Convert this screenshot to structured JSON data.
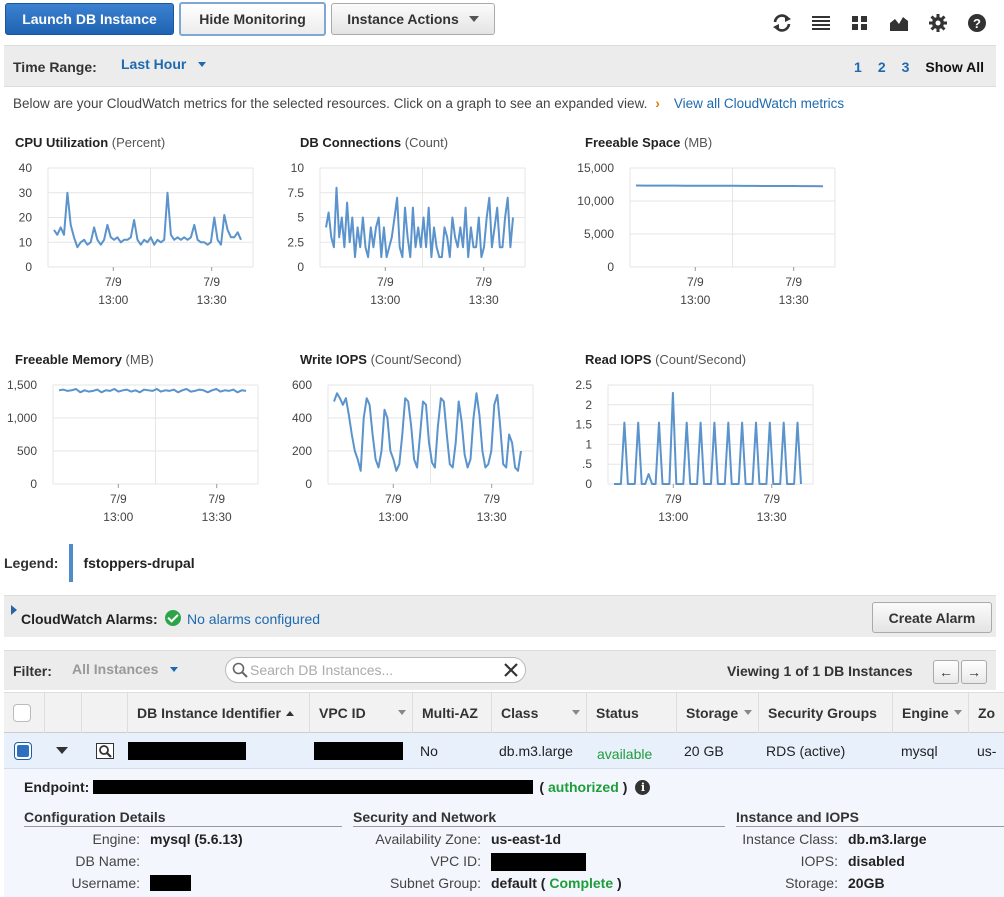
{
  "toolbar": {
    "launch_label": "Launch DB Instance",
    "hide_monitoring_label": "Hide Monitoring",
    "instance_actions_label": "Instance Actions",
    "icons": [
      "refresh-icon",
      "list-view-icon",
      "grid-view-icon",
      "area-chart-icon",
      "gear-icon",
      "help-icon"
    ]
  },
  "time_range": {
    "label": "Time Range:",
    "value": "Last Hour",
    "pages": [
      "1",
      "2",
      "3"
    ],
    "show_all": "Show All"
  },
  "intro": {
    "text": "Below are your CloudWatch metrics for the selected resources. Click on a graph to see an expanded view.",
    "arrow": "›",
    "link": "View all CloudWatch metrics"
  },
  "chart_data": [
    {
      "type": "line",
      "title": "CPU Utilization",
      "unit": "(Percent)",
      "ylim": [
        0,
        40
      ],
      "yticks": [
        "0",
        "10",
        "20",
        "30",
        "40"
      ],
      "xticks": [
        [
          "7/9",
          "13:00"
        ],
        [
          "7/9",
          "13:30"
        ]
      ],
      "color": "#5b93cc",
      "values": [
        15,
        13,
        16,
        13,
        30,
        17,
        12,
        8,
        10,
        11,
        9,
        10,
        16,
        11,
        9,
        11,
        17,
        12,
        11,
        12,
        10,
        11,
        11,
        12,
        19,
        11,
        9,
        11,
        10,
        12,
        9,
        11,
        10,
        11,
        30,
        13,
        11,
        12,
        11,
        12,
        11,
        12,
        17,
        11,
        10,
        10,
        9,
        10,
        20,
        11,
        9,
        21,
        15,
        12,
        12,
        14,
        11
      ]
    },
    {
      "type": "line",
      "title": "DB Connections",
      "unit": "(Count)",
      "ylim": [
        0,
        10
      ],
      "yticks": [
        "0",
        "2.5",
        "5",
        "7.5",
        "10"
      ],
      "xticks": [
        [
          "7/9",
          "13:00"
        ],
        [
          "7/9",
          "13:30"
        ]
      ],
      "color": "#5b93cc",
      "values": [
        4,
        5.5,
        3,
        2,
        8,
        3,
        5,
        2,
        6.5,
        2.5,
        5,
        1,
        4,
        2,
        5,
        2,
        1,
        4,
        2,
        4,
        5,
        1,
        4,
        1,
        2,
        3,
        5,
        7,
        2,
        1,
        6,
        3,
        1,
        6,
        2,
        4,
        2,
        5,
        2,
        6,
        1,
        4,
        2,
        1,
        1,
        4,
        3,
        1,
        5,
        3,
        2,
        4,
        2,
        6,
        1,
        4,
        2,
        2,
        5,
        1,
        2,
        5,
        7,
        2,
        4,
        6,
        2,
        2,
        5,
        7,
        2,
        5
      ]
    },
    {
      "type": "line",
      "title": "Freeable Space",
      "unit": "(MB)",
      "ylim": [
        0,
        15000
      ],
      "yticks": [
        "0",
        "5,000",
        "10,000",
        "15,000"
      ],
      "xticks": [
        [
          "7/9",
          "13:00"
        ],
        [
          "7/9",
          "13:30"
        ]
      ],
      "color": "#5b93cc",
      "values": [
        12350,
        12340,
        12340,
        12330,
        12330,
        12320,
        12320,
        12310,
        12310,
        12300,
        12300,
        12290,
        12290,
        12280,
        12280,
        12270,
        12270,
        12260,
        12260,
        12250
      ]
    },
    {
      "type": "line",
      "title": "Freeable Memory",
      "unit": "(MB)",
      "ylim": [
        0,
        1500
      ],
      "yticks": [
        "0",
        "500",
        "1,000",
        "1,500"
      ],
      "xticks": [
        [
          "7/9",
          "13:00"
        ],
        [
          "7/9",
          "13:30"
        ]
      ],
      "color": "#5b93cc",
      "values": [
        1420,
        1430,
        1410,
        1420,
        1440,
        1390,
        1420,
        1400,
        1410,
        1430,
        1390,
        1420,
        1410,
        1440,
        1400,
        1420,
        1430,
        1400,
        1420,
        1390,
        1430,
        1420,
        1410,
        1440,
        1400,
        1420,
        1410,
        1430,
        1390,
        1420,
        1440,
        1400,
        1410,
        1430,
        1420,
        1390,
        1420,
        1440,
        1400,
        1420,
        1410,
        1430,
        1390,
        1420,
        1410
      ]
    },
    {
      "type": "line",
      "title": "Write IOPS",
      "unit": "(Count/Second)",
      "ylim": [
        0,
        600
      ],
      "yticks": [
        "0",
        "200",
        "400",
        "600"
      ],
      "xticks": [
        [
          "7/9",
          "13:00"
        ],
        [
          "7/9",
          "13:30"
        ]
      ],
      "color": "#5b93cc",
      "values": [
        500,
        550,
        520,
        480,
        520,
        420,
        300,
        200,
        150,
        80,
        400,
        520,
        480,
        300,
        150,
        100,
        200,
        450,
        400,
        200,
        150,
        80,
        120,
        300,
        520,
        500,
        350,
        150,
        100,
        300,
        500,
        480,
        250,
        130,
        100,
        350,
        520,
        500,
        300,
        120,
        100,
        250,
        500,
        380,
        180,
        100,
        150,
        400,
        550,
        420,
        200,
        100,
        120,
        200,
        480,
        540,
        350,
        120,
        100,
        300,
        250,
        100,
        80,
        200
      ]
    },
    {
      "type": "line",
      "title": "Read IOPS",
      "unit": "(Count/Second)",
      "ylim": [
        0,
        2.5
      ],
      "yticks": [
        "0",
        ".5",
        "1",
        "1.5",
        "2",
        "2.5"
      ],
      "xticks": [
        [
          "7/9",
          "13:00"
        ],
        [
          "7/9",
          "13:30"
        ]
      ],
      "color": "#5b93cc",
      "values": [
        0,
        0,
        0,
        1.55,
        0,
        0,
        0,
        1.55,
        0,
        0,
        0.25,
        0,
        0,
        1.55,
        0,
        0,
        0,
        2.3,
        0,
        0,
        0,
        1.55,
        0,
        0,
        0,
        1.55,
        0,
        0,
        0,
        1.55,
        0,
        0,
        0,
        1.55,
        0,
        0,
        0,
        1.55,
        0,
        0,
        0,
        1.55,
        0,
        0,
        0,
        1.55,
        0,
        0,
        0,
        1.55,
        0,
        0,
        0,
        1.55,
        0
      ]
    }
  ],
  "legend": {
    "label": "Legend:",
    "series": "fstoppers-drupal",
    "color": "#4f8cc9"
  },
  "alarms": {
    "label": "CloudWatch Alarms:",
    "message": "No alarms configured",
    "create_label": "Create Alarm"
  },
  "filter": {
    "label": "Filter:",
    "value": "All Instances",
    "search_placeholder": "Search DB Instances...",
    "viewing": "Viewing 1 of 1 DB Instances",
    "prev": "←",
    "next": "→"
  },
  "table": {
    "columns": {
      "identifier": "DB Instance Identifier",
      "vpc": "VPC ID",
      "multi_az": "Multi-AZ",
      "class": "Class",
      "status": "Status",
      "storage": "Storage",
      "security_groups": "Security Groups",
      "engine": "Engine",
      "zone": "Zo"
    },
    "row": {
      "multi_az": "No",
      "class": "db.m3.large",
      "status": "available",
      "storage": "20 GB",
      "security_groups": "RDS (active)",
      "engine": "mysql",
      "zone": "us-"
    }
  },
  "details": {
    "endpoint_label": "Endpoint:",
    "endpoint_open": "(",
    "endpoint_status": "authorized",
    "endpoint_close": ")",
    "info_glyph": "i",
    "config": {
      "title": "Configuration Details",
      "engine_k": "Engine:",
      "engine_v": "mysql (5.6.13)",
      "dbname_k": "DB Name:",
      "username_k": "Username:"
    },
    "security": {
      "title": "Security and Network",
      "az_k": "Availability Zone:",
      "az_v": "us-east-1d",
      "vpc_k": "VPC ID:",
      "subnet_k": "Subnet Group:",
      "subnet_v1": "default (",
      "subnet_v2": "Complete",
      "subnet_v3": ")"
    },
    "iops": {
      "title": "Instance and IOPS",
      "class_k": "Instance Class:",
      "class_v": "db.m3.large",
      "iops_k": "IOPS:",
      "iops_v": "disabled",
      "storage_k": "Storage:",
      "storage_v": "20GB"
    }
  }
}
